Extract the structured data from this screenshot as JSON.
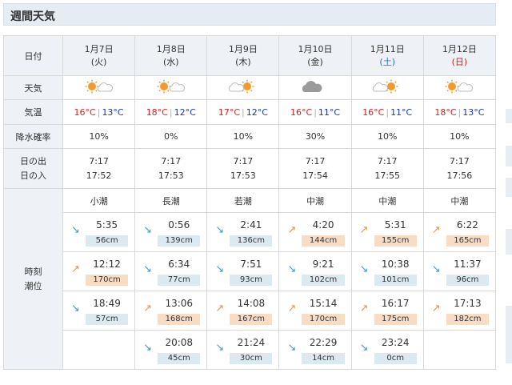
{
  "section_title": "週間天気",
  "labels": {
    "date": "日付",
    "weather": "天気",
    "temp": "気温",
    "rain": "降水確率",
    "sunrise": "日の出",
    "sunset": "日の入",
    "tide_time": "時刻",
    "tide_level": "潮位"
  },
  "days": [
    {
      "date": "1月7日",
      "dow": "(火)",
      "dow_color": "normal",
      "weather": "sunny-cloudy",
      "high": "16°C",
      "low": "13°C",
      "rain": "10%",
      "sunrise": "7:17",
      "sunset": "17:52",
      "tide_name": "小潮"
    },
    {
      "date": "1月8日",
      "dow": "(水)",
      "dow_color": "normal",
      "weather": "sunny-cloudy",
      "high": "18°C",
      "low": "12°C",
      "rain": "0%",
      "sunrise": "7:17",
      "sunset": "17:53",
      "tide_name": "長潮"
    },
    {
      "date": "1月9日",
      "dow": "(木)",
      "dow_color": "normal",
      "weather": "cloudy-sunny",
      "high": "17°C",
      "low": "12°C",
      "rain": "10%",
      "sunrise": "7:17",
      "sunset": "17:53",
      "tide_name": "若潮"
    },
    {
      "date": "1月10日",
      "dow": "(金)",
      "dow_color": "normal",
      "weather": "cloudy",
      "high": "16°C",
      "low": "11°C",
      "rain": "30%",
      "sunrise": "7:17",
      "sunset": "17:54",
      "tide_name": "中潮"
    },
    {
      "date": "1月11日",
      "dow": "(土)",
      "dow_color": "sat",
      "weather": "cloudy-sunny",
      "high": "16°C",
      "low": "11°C",
      "rain": "10%",
      "sunrise": "7:17",
      "sunset": "17:55",
      "tide_name": "中潮"
    },
    {
      "date": "1月12日",
      "dow": "(日)",
      "dow_color": "sun",
      "weather": "sunny-cloudy",
      "high": "18°C",
      "low": "13°C",
      "rain": "10%",
      "sunrise": "7:17",
      "sunset": "17:56",
      "tide_name": "中潮"
    }
  ],
  "tides": [
    [
      {
        "dir": "down",
        "time": "5:35",
        "height": "56cm"
      },
      {
        "dir": "down",
        "time": "0:56",
        "height": "139cm"
      },
      {
        "dir": "down",
        "time": "2:41",
        "height": "136cm"
      },
      {
        "dir": "up",
        "time": "4:20",
        "height": "144cm"
      },
      {
        "dir": "up",
        "time": "5:31",
        "height": "155cm"
      },
      {
        "dir": "up",
        "time": "6:22",
        "height": "165cm"
      }
    ],
    [
      {
        "dir": "up",
        "time": "12:12",
        "height": "170cm"
      },
      {
        "dir": "down",
        "time": "6:34",
        "height": "77cm"
      },
      {
        "dir": "down",
        "time": "7:51",
        "height": "93cm"
      },
      {
        "dir": "down",
        "time": "9:21",
        "height": "102cm"
      },
      {
        "dir": "down",
        "time": "10:38",
        "height": "101cm"
      },
      {
        "dir": "down",
        "time": "11:37",
        "height": "96cm"
      }
    ],
    [
      {
        "dir": "down",
        "time": "18:49",
        "height": "57cm"
      },
      {
        "dir": "up",
        "time": "13:06",
        "height": "168cm"
      },
      {
        "dir": "up",
        "time": "14:08",
        "height": "167cm"
      },
      {
        "dir": "up",
        "time": "15:14",
        "height": "170cm"
      },
      {
        "dir": "up",
        "time": "16:17",
        "height": "175cm"
      },
      {
        "dir": "up",
        "time": "17:13",
        "height": "182cm"
      }
    ],
    [
      null,
      {
        "dir": "down",
        "time": "20:08",
        "height": "45cm"
      },
      {
        "dir": "down",
        "time": "21:24",
        "height": "30cm"
      },
      {
        "dir": "down",
        "time": "22:29",
        "height": "14cm"
      },
      {
        "dir": "down",
        "time": "23:24",
        "height": "0cm"
      },
      null
    ]
  ],
  "colors": {
    "high_temp": "#e01b1b",
    "low_temp": "#1733c8",
    "saturday": "#2a6ad8",
    "sunday": "#d62020",
    "rising_tide": "#e8934a",
    "falling_tide": "#3c9ad6",
    "low_tide_badge": "#dbe9f0",
    "high_tide_badge": "#f9dcc4"
  }
}
